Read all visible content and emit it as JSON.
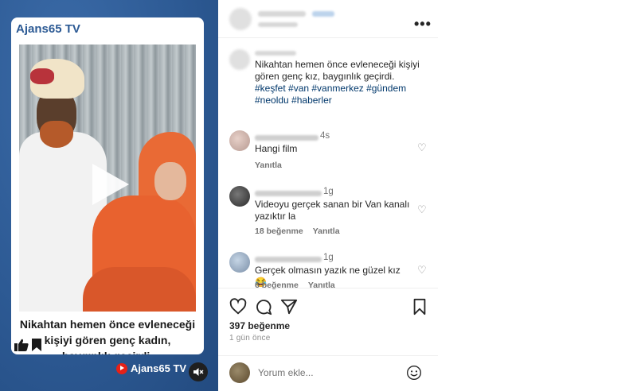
{
  "video": {
    "channel_title": "Ajans65 TV",
    "caption": "Nikahtan hemen önce evleneceği kişiyi gören genç kadın, baygınlık geçirdi.",
    "brand_name": "Ajans65 TV",
    "icons": [
      "play-icon",
      "thumbs-up-icon",
      "bookmark-icon",
      "youtube-logo-icon",
      "mute-icon"
    ]
  },
  "post": {
    "caption": "Nikahtan hemen önce evleneceği kişiyi gören genç kız, baygınlık geçirdi.",
    "hashtags": "#keşfet #van #vanmerkez #gündem #neoldu #haberler"
  },
  "comments": [
    {
      "time": "4s",
      "text": "Hangi film",
      "reply_label": "Yanıtla",
      "likes_label": ""
    },
    {
      "time": "1g",
      "text": "Videoyu gerçek sanan bir Van kanalı yazıktır la",
      "reply_label": "Yanıtla",
      "likes_label": "18 beğenme"
    },
    {
      "time": "1g",
      "text": "Gerçek olmasın yazık ne güzel kız 😂",
      "reply_label": "Yanıtla",
      "likes_label": "6 beğenme"
    }
  ],
  "actions": {
    "likes": "397 beğenme",
    "time_ago": "1 gün önce",
    "comment_placeholder": "Yorum ekle..."
  }
}
